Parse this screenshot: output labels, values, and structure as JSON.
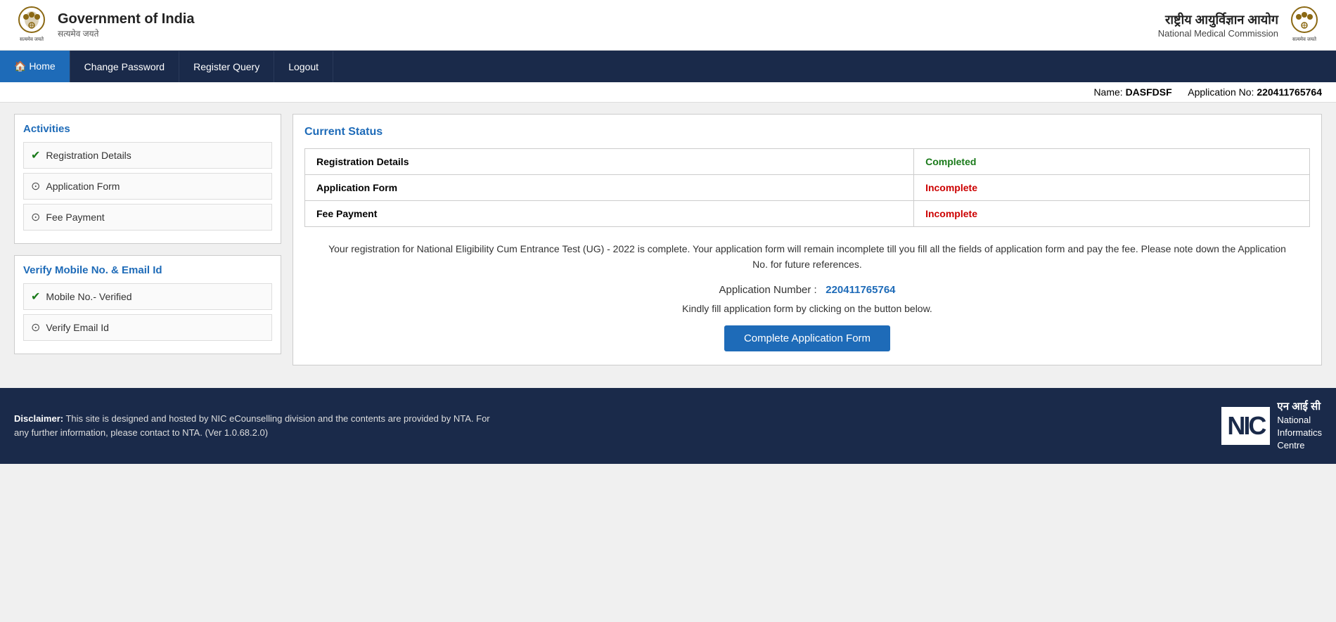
{
  "header": {
    "gov_logo_alt": "Government of India Emblem",
    "gov_title": "Government of India",
    "gov_subtitle": "सत्यमेव जयते",
    "nmc_title": "राष्ट्रीय आयुर्विज्ञान आयोग",
    "nmc_subtitle": "National Medical Commission",
    "nmc_logo_alt": "NMC Logo"
  },
  "navbar": {
    "items": [
      {
        "label": "🏠 Home",
        "active": true
      },
      {
        "label": "Change Password",
        "active": false
      },
      {
        "label": "Register Query",
        "active": false
      },
      {
        "label": "Logout",
        "active": false
      }
    ]
  },
  "user_bar": {
    "name_label": "Name:",
    "name_value": "DASFDSF",
    "app_label": "Application No:",
    "app_value": "220411765764"
  },
  "sidebar": {
    "activities_title": "Activities",
    "activities_items": [
      {
        "label": "Registration Details",
        "status": "check"
      },
      {
        "label": "Application Form",
        "status": "circle"
      },
      {
        "label": "Fee Payment",
        "status": "circle"
      }
    ],
    "verify_title": "Verify Mobile No. & Email Id",
    "verify_items": [
      {
        "label": "Mobile No.- Verified",
        "status": "check"
      },
      {
        "label": "Verify Email Id",
        "status": "circle"
      }
    ]
  },
  "status_panel": {
    "title": "Current Status",
    "table_rows": [
      {
        "item": "Registration Details",
        "status": "Completed",
        "status_class": "completed"
      },
      {
        "item": "Application Form",
        "status": "Incomplete",
        "status_class": "incomplete"
      },
      {
        "item": "Fee Payment",
        "status": "Incomplete",
        "status_class": "incomplete"
      }
    ],
    "info_text": "Your registration for National Eligibility Cum Entrance Test (UG) - 2022 is complete. Your application form will remain incomplete till you fill all the fields of application form and pay the fee. Please note down the Application No. for future references.",
    "app_number_label": "Application Number :",
    "app_number_value": "220411765764",
    "fill_text": "Kindly fill application form by clicking on the button below.",
    "complete_button": "Complete Application Form"
  },
  "footer": {
    "disclaimer_label": "Disclaimer:",
    "disclaimer_text": "This site is designed and hosted by NIC eCounselling division and the contents are provided by NTA. For any further information, please contact to NTA. (Ver 1.0.68.2.0)",
    "nic_hindi": "एन आई सी",
    "nic_line1": "National",
    "nic_line2": "Informatics",
    "nic_line3": "Centre"
  }
}
